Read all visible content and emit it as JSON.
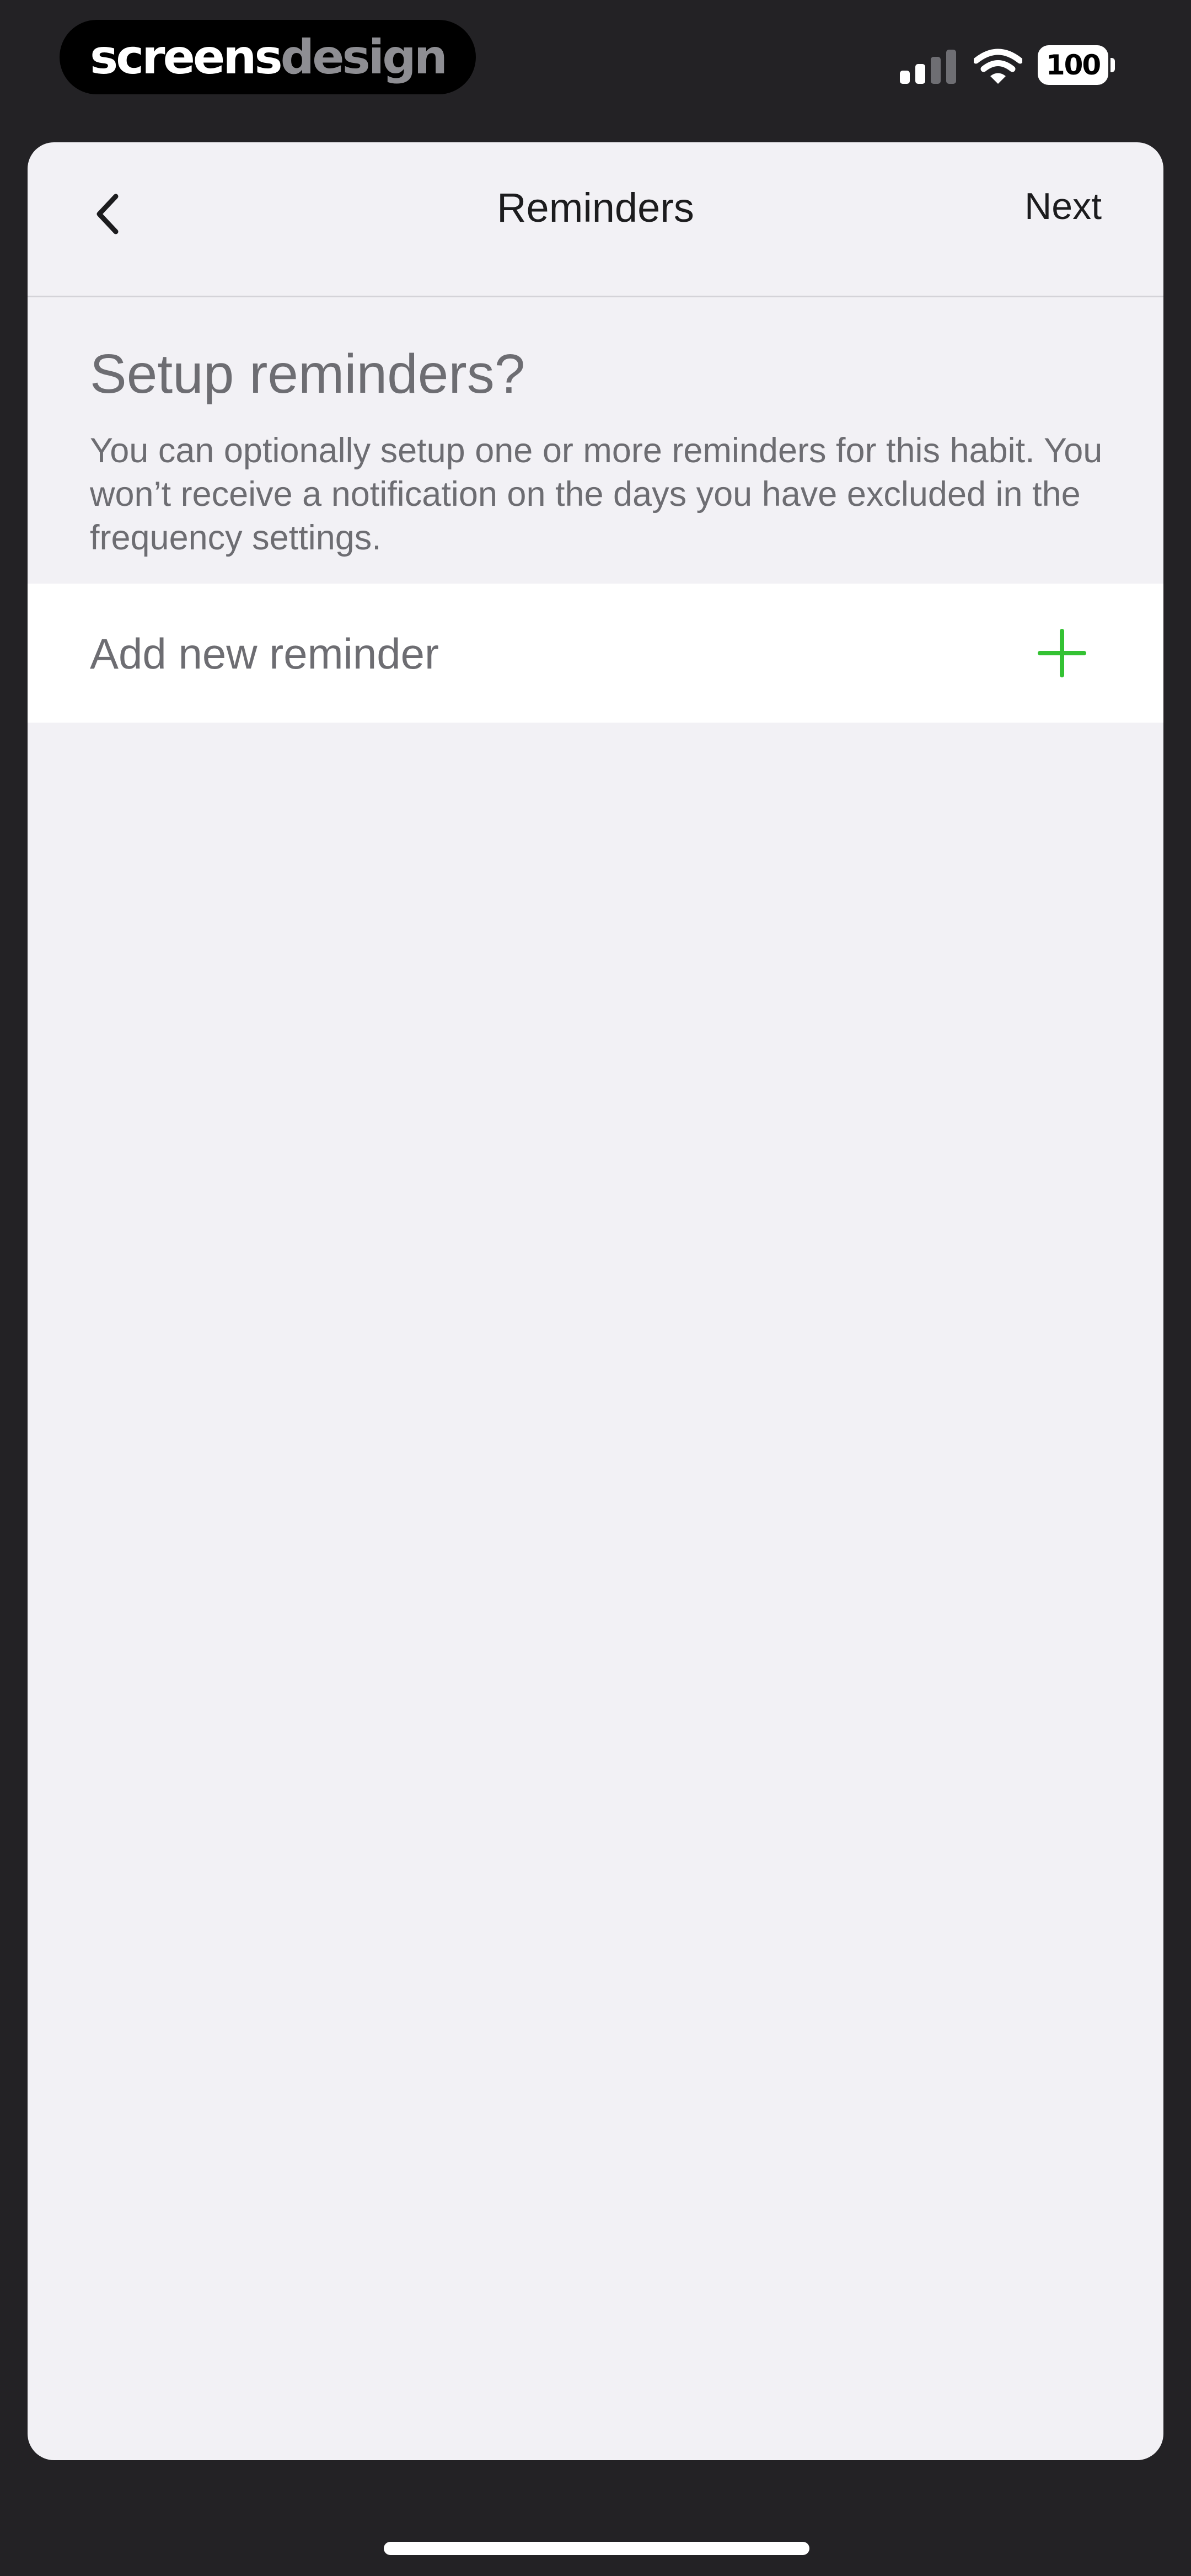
{
  "status_bar": {
    "brand_part1": "screens",
    "brand_part2": "design",
    "battery": "100",
    "signal_icon": "cellular-signal-icon",
    "wifi_icon": "wifi-icon"
  },
  "nav": {
    "title": "Reminders",
    "next_label": "Next",
    "back_icon": "chevron-left-icon"
  },
  "section": {
    "title": "Setup reminders?",
    "description": "You can optionally setup one or more reminders for this habit. You won’t receive a notification on the days you have excluded in the frequency settings."
  },
  "reminder_row": {
    "label": "Add new reminder",
    "icon": "plus-icon"
  },
  "colors": {
    "accent": "#34c233",
    "background": "#f2f1f5",
    "text_secondary": "#6d6d72",
    "text_primary": "#1c1c1e"
  }
}
